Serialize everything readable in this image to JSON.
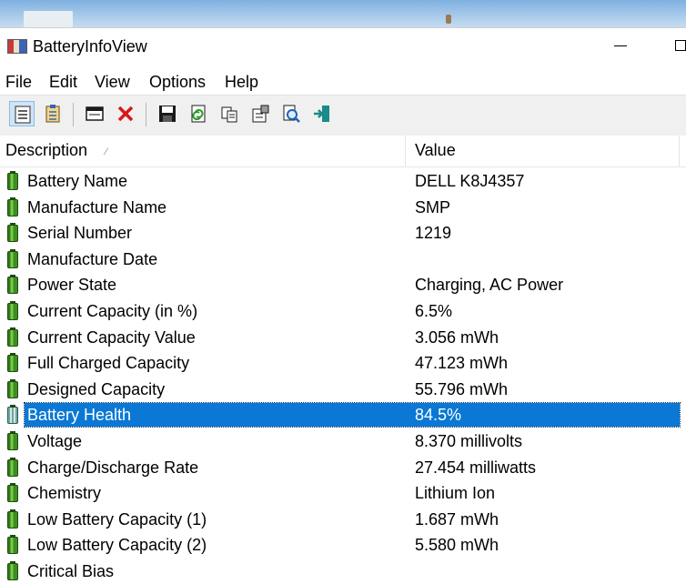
{
  "window": {
    "title": "BatteryInfoView"
  },
  "menu": [
    "File",
    "Edit",
    "View",
    "Options",
    "Help"
  ],
  "toolbar": {
    "icons": [
      "html-report-icon",
      "properties-list-icon",
      "window-icon",
      "delete-icon",
      "save-icon",
      "refresh-icon",
      "copy-icon",
      "properties-icon",
      "find-icon",
      "exit-icon"
    ]
  },
  "columns": {
    "description": "Description",
    "value": "Value",
    "sort_indicator": "⁄"
  },
  "rows": [
    {
      "description": "Battery Name",
      "value": "DELL K8J4357"
    },
    {
      "description": "Manufacture Name",
      "value": "SMP"
    },
    {
      "description": "Serial Number",
      "value": "1219"
    },
    {
      "description": "Manufacture Date",
      "value": ""
    },
    {
      "description": "Power State",
      "value": "Charging, AC Power"
    },
    {
      "description": "Current Capacity (in %)",
      "value": "6.5%"
    },
    {
      "description": "Current Capacity Value",
      "value": "3.056 mWh"
    },
    {
      "description": "Full Charged Capacity",
      "value": "47.123 mWh"
    },
    {
      "description": "Designed Capacity",
      "value": "55.796 mWh"
    },
    {
      "description": "Battery Health",
      "value": "84.5%"
    },
    {
      "description": "Voltage",
      "value": "8.370 millivolts"
    },
    {
      "description": "Charge/Discharge Rate",
      "value": "27.454 milliwatts"
    },
    {
      "description": "Chemistry",
      "value": "Lithium Ion"
    },
    {
      "description": "Low Battery Capacity (1)",
      "value": "1.687 mWh"
    },
    {
      "description": "Low Battery Capacity (2)",
      "value": "5.580 mWh"
    },
    {
      "description": "Critical Bias",
      "value": ""
    }
  ],
  "selected_row": "Battery Health",
  "colors": {
    "selection": "#0a78d4",
    "battery_green": "#3b8f20",
    "toolbar_bg": "#f0f0f0"
  }
}
